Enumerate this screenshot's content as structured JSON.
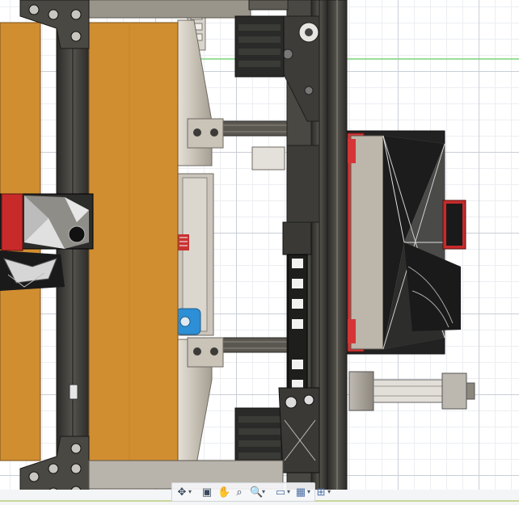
{
  "viewport": {
    "background": "#ffffff",
    "grid_major": "#c9ced6",
    "grid_minor": "#eceef2"
  },
  "colors": {
    "build_plate": "#d18e30",
    "frame_dark": "#3b3a36",
    "frame_metal": "#8f8a80",
    "accent_red": "#c82a2a",
    "accent_blue": "#2d8fd5",
    "motor_black": "#2a2a28",
    "housing_grey": "#bdb6aa"
  },
  "navbar": {
    "tools": [
      {
        "name": "orbit-tool",
        "icon": "orbit-icon",
        "glyph": "✥",
        "dropdown": true
      },
      {
        "name": "look-at-tool",
        "icon": "look-at-icon",
        "glyph": "▣",
        "dropdown": false
      },
      {
        "name": "pan-tool",
        "icon": "hand-icon",
        "glyph": "✋",
        "dropdown": false
      },
      {
        "name": "zoom-window-tool",
        "icon": "zoom-window-icon",
        "glyph": "⌕",
        "dropdown": false
      },
      {
        "name": "zoom-tool",
        "icon": "magnifier-icon",
        "glyph": "🔍",
        "dropdown": true
      },
      {
        "name": "display-settings-tool",
        "icon": "display-settings-icon",
        "glyph": "▭",
        "dropdown": true
      },
      {
        "name": "grid-snaps-tool",
        "icon": "grid-icon",
        "glyph": "▦",
        "dropdown": true
      },
      {
        "name": "viewports-tool",
        "icon": "viewports-icon",
        "glyph": "⊞",
        "dropdown": true
      }
    ]
  }
}
